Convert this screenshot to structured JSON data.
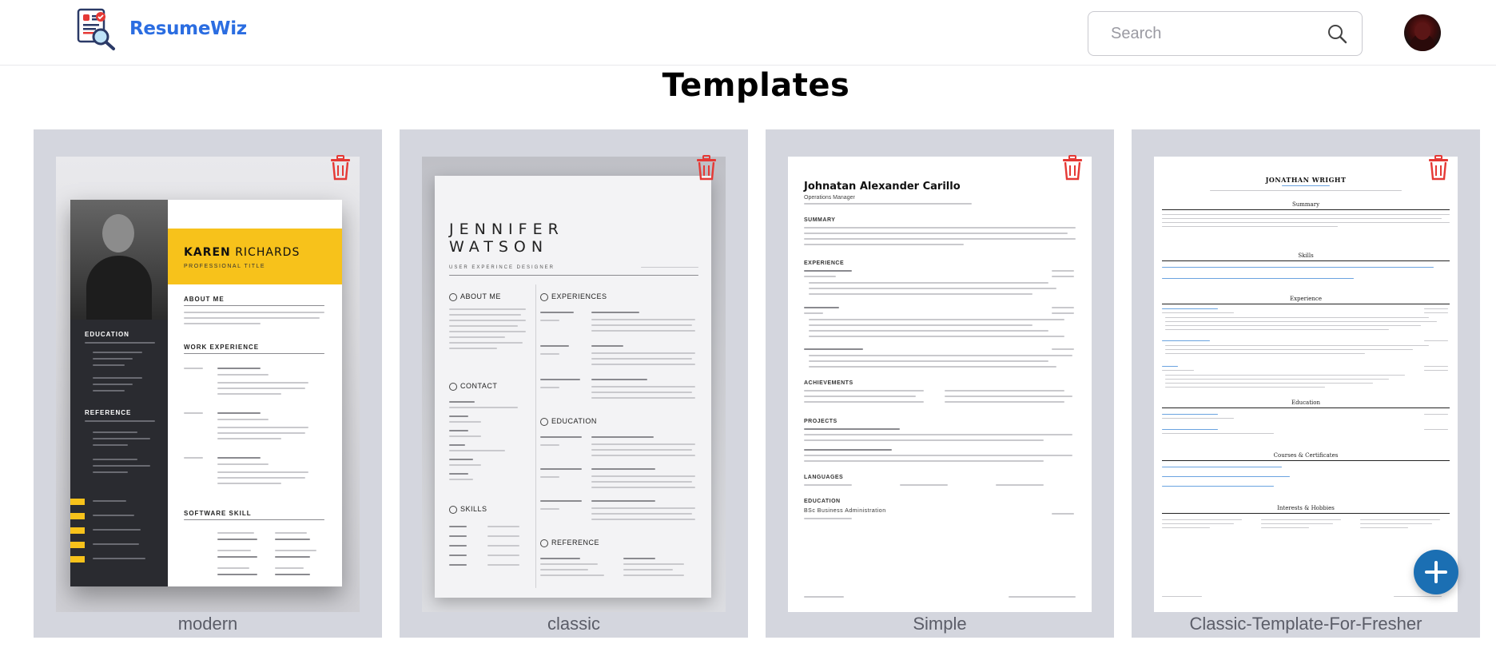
{
  "header": {
    "brand": "ResumeWiz",
    "search": {
      "placeholder": "Search",
      "value": ""
    }
  },
  "page": {
    "title": "Templates"
  },
  "templates": [
    {
      "label": "modern",
      "preview": {
        "name_first": "KAREN",
        "name_last": "RICHARDS",
        "subtitle": "PROFESSIONAL TITLE",
        "about": "ABOUT ME",
        "work": "WORK EXPERIENCE",
        "education": "EDUCATION",
        "reference": "REFERENCE",
        "skill": "SOFTWARE SKILL"
      }
    },
    {
      "label": "classic",
      "preview": {
        "name_line1": "JENNIFER",
        "name_line2": "WATSON",
        "subtitle": "USER EXPERINCE DESIGNER",
        "about": "ABOUT ME",
        "contact": "CONTACT",
        "skills": "SKILLS",
        "experiences": "EXPERIENCES",
        "education": "EDUCATION",
        "reference": "REFERENCE"
      }
    },
    {
      "label": "Simple",
      "preview": {
        "name": "Johnatan Alexander Carillo",
        "subtitle": "Operations Manager",
        "summary": "SUMMARY",
        "experience": "EXPERIENCE",
        "achievements": "ACHIEVEMENTS",
        "projects": "PROJECTS",
        "languages": "LANGUAGES",
        "education": "EDUCATION",
        "degree": "BSc Business Administration"
      }
    },
    {
      "label": "Classic-Template-For-Fresher",
      "preview": {
        "name": "JONATHAN WRIGHT",
        "summary": "Summary",
        "skills": "Skills",
        "experience": "Experience",
        "education": "Education",
        "courses": "Courses & Certificates",
        "interests": "Interests & Hobbies"
      }
    }
  ],
  "colors": {
    "brand": "#2b6de1",
    "delete": "#e53935",
    "fab": "#1b6fb3",
    "card_bg": "#d4d6de"
  },
  "icons": {
    "search": "search-icon",
    "delete": "trash-icon",
    "add": "plus-icon"
  }
}
